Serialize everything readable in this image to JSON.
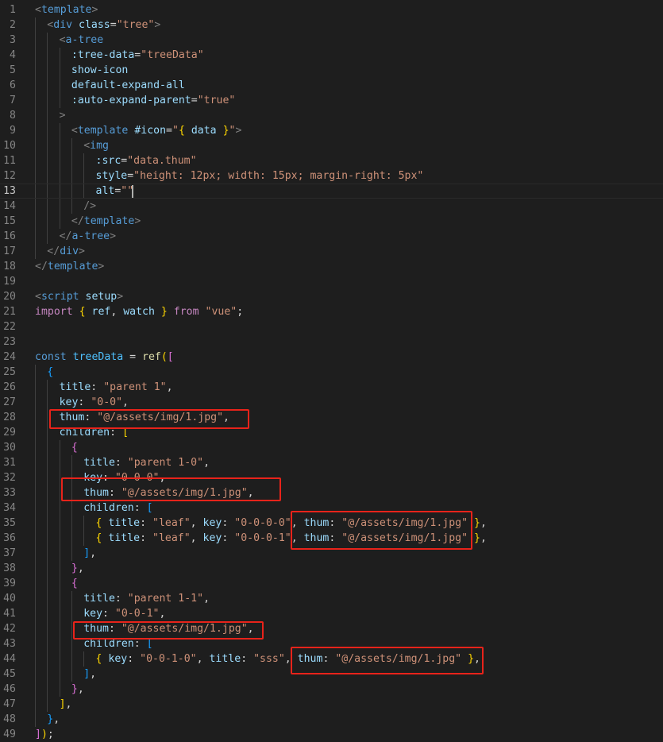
{
  "editor": {
    "language": "vue",
    "cursor_line": 13,
    "lines": [
      {
        "n": "1",
        "indent": 0,
        "tokens": [
          [
            "punc",
            "<"
          ],
          [
            "tag",
            "template"
          ],
          [
            "punc",
            ">"
          ]
        ]
      },
      {
        "n": "2",
        "indent": 1,
        "tokens": [
          [
            "punc",
            "<"
          ],
          [
            "tag",
            "div"
          ],
          [
            "txt",
            " "
          ],
          [
            "attr",
            "class"
          ],
          [
            "txt",
            "="
          ],
          [
            "str",
            "\"tree\""
          ],
          [
            "punc",
            ">"
          ]
        ]
      },
      {
        "n": "3",
        "indent": 2,
        "tokens": [
          [
            "punc",
            "<"
          ],
          [
            "tag",
            "a-tree"
          ]
        ]
      },
      {
        "n": "4",
        "indent": 3,
        "tokens": [
          [
            "attr",
            ":tree-data"
          ],
          [
            "txt",
            "="
          ],
          [
            "str",
            "\"treeData\""
          ]
        ]
      },
      {
        "n": "5",
        "indent": 3,
        "tokens": [
          [
            "attr",
            "show-icon"
          ]
        ]
      },
      {
        "n": "6",
        "indent": 3,
        "tokens": [
          [
            "attr",
            "default-expand-all"
          ]
        ]
      },
      {
        "n": "7",
        "indent": 3,
        "tokens": [
          [
            "attr",
            ":auto-expand-parent"
          ],
          [
            "txt",
            "="
          ],
          [
            "str",
            "\"true\""
          ]
        ]
      },
      {
        "n": "8",
        "indent": 2,
        "tokens": [
          [
            "punc",
            ">"
          ]
        ]
      },
      {
        "n": "9",
        "indent": 3,
        "tokens": [
          [
            "punc",
            "<"
          ],
          [
            "tag",
            "template"
          ],
          [
            "txt",
            " "
          ],
          [
            "attr",
            "#icon"
          ],
          [
            "txt",
            "="
          ],
          [
            "str",
            "\""
          ],
          [
            "br1",
            "{"
          ],
          [
            "txt",
            " "
          ],
          [
            "attr",
            "data"
          ],
          [
            "txt",
            " "
          ],
          [
            "br1",
            "}"
          ],
          [
            "str",
            "\""
          ],
          [
            "punc",
            ">"
          ]
        ]
      },
      {
        "n": "10",
        "indent": 4,
        "tokens": [
          [
            "punc",
            "<"
          ],
          [
            "tag",
            "img"
          ]
        ]
      },
      {
        "n": "11",
        "indent": 5,
        "tokens": [
          [
            "attr",
            ":src"
          ],
          [
            "txt",
            "="
          ],
          [
            "str",
            "\"data.thum\""
          ]
        ]
      },
      {
        "n": "12",
        "indent": 5,
        "tokens": [
          [
            "attr",
            "style"
          ],
          [
            "txt",
            "="
          ],
          [
            "str",
            "\"height: 12px; width: 15px; margin-right: 5px\""
          ]
        ]
      },
      {
        "n": "13",
        "indent": 5,
        "tokens": [
          [
            "attr",
            "alt"
          ],
          [
            "txt",
            "="
          ],
          [
            "str",
            "\"\""
          ]
        ]
      },
      {
        "n": "14",
        "indent": 4,
        "tokens": [
          [
            "punc",
            "/>"
          ]
        ]
      },
      {
        "n": "15",
        "indent": 3,
        "tokens": [
          [
            "punc",
            "</"
          ],
          [
            "tag",
            "template"
          ],
          [
            "punc",
            ">"
          ]
        ]
      },
      {
        "n": "16",
        "indent": 2,
        "tokens": [
          [
            "punc",
            "</"
          ],
          [
            "tag",
            "a-tree"
          ],
          [
            "punc",
            ">"
          ]
        ]
      },
      {
        "n": "17",
        "indent": 1,
        "tokens": [
          [
            "punc",
            "</"
          ],
          [
            "tag",
            "div"
          ],
          [
            "punc",
            ">"
          ]
        ]
      },
      {
        "n": "18",
        "indent": 0,
        "tokens": [
          [
            "punc",
            "</"
          ],
          [
            "tag",
            "template"
          ],
          [
            "punc",
            ">"
          ]
        ]
      },
      {
        "n": "19",
        "indent": 0,
        "tokens": []
      },
      {
        "n": "20",
        "indent": 0,
        "tokens": [
          [
            "punc",
            "<"
          ],
          [
            "tag",
            "script"
          ],
          [
            "txt",
            " "
          ],
          [
            "attr",
            "setup"
          ],
          [
            "punc",
            ">"
          ]
        ]
      },
      {
        "n": "21",
        "indent": 0,
        "tokens": [
          [
            "kw",
            "import"
          ],
          [
            "txt",
            " "
          ],
          [
            "br1",
            "{"
          ],
          [
            "txt",
            " "
          ],
          [
            "prop",
            "ref"
          ],
          [
            "txt",
            ", "
          ],
          [
            "prop",
            "watch"
          ],
          [
            "txt",
            " "
          ],
          [
            "br1",
            "}"
          ],
          [
            "txt",
            " "
          ],
          [
            "kw",
            "from"
          ],
          [
            "txt",
            " "
          ],
          [
            "str",
            "\"vue\""
          ],
          [
            "txt",
            ";"
          ]
        ]
      },
      {
        "n": "22",
        "indent": 0,
        "tokens": []
      },
      {
        "n": "23",
        "indent": 0,
        "tokens": []
      },
      {
        "n": "24",
        "indent": 0,
        "tokens": [
          [
            "kwb",
            "const"
          ],
          [
            "txt",
            " "
          ],
          [
            "var",
            "treeData"
          ],
          [
            "txt",
            " = "
          ],
          [
            "fn",
            "ref"
          ],
          [
            "br1",
            "("
          ],
          [
            "br2",
            "["
          ]
        ]
      },
      {
        "n": "25",
        "indent": 1,
        "tokens": [
          [
            "br3",
            "{"
          ]
        ]
      },
      {
        "n": "26",
        "indent": 2,
        "tokens": [
          [
            "prop",
            "title"
          ],
          [
            "txt",
            ": "
          ],
          [
            "str",
            "\"parent 1\""
          ],
          [
            "txt",
            ","
          ]
        ]
      },
      {
        "n": "27",
        "indent": 2,
        "tokens": [
          [
            "prop",
            "key"
          ],
          [
            "txt",
            ": "
          ],
          [
            "str",
            "\"0-0\""
          ],
          [
            "txt",
            ","
          ]
        ]
      },
      {
        "n": "28",
        "indent": 2,
        "tokens": [
          [
            "prop",
            "thum"
          ],
          [
            "txt",
            ": "
          ],
          [
            "str",
            "\"@/assets/img/1.jpg\""
          ],
          [
            "txt",
            ","
          ]
        ]
      },
      {
        "n": "29",
        "indent": 2,
        "tokens": [
          [
            "prop",
            "children"
          ],
          [
            "txt",
            ": "
          ],
          [
            "br1",
            "["
          ]
        ]
      },
      {
        "n": "30",
        "indent": 3,
        "tokens": [
          [
            "br2",
            "{"
          ]
        ]
      },
      {
        "n": "31",
        "indent": 4,
        "tokens": [
          [
            "prop",
            "title"
          ],
          [
            "txt",
            ": "
          ],
          [
            "str",
            "\"parent 1-0\""
          ],
          [
            "txt",
            ","
          ]
        ]
      },
      {
        "n": "32",
        "indent": 4,
        "tokens": [
          [
            "prop",
            "key"
          ],
          [
            "txt",
            ": "
          ],
          [
            "str",
            "\"0-0-0\""
          ],
          [
            "txt",
            ","
          ]
        ]
      },
      {
        "n": "33",
        "indent": 4,
        "tokens": [
          [
            "prop",
            "thum"
          ],
          [
            "txt",
            ": "
          ],
          [
            "str",
            "\"@/assets/img/1.jpg\""
          ],
          [
            "txt",
            ","
          ]
        ]
      },
      {
        "n": "34",
        "indent": 4,
        "tokens": [
          [
            "prop",
            "children"
          ],
          [
            "txt",
            ": "
          ],
          [
            "br3",
            "["
          ]
        ]
      },
      {
        "n": "35",
        "indent": 5,
        "tokens": [
          [
            "br1",
            "{"
          ],
          [
            "txt",
            " "
          ],
          [
            "prop",
            "title"
          ],
          [
            "txt",
            ": "
          ],
          [
            "str",
            "\"leaf\""
          ],
          [
            "txt",
            ", "
          ],
          [
            "prop",
            "key"
          ],
          [
            "txt",
            ": "
          ],
          [
            "str",
            "\"0-0-0-0\""
          ],
          [
            "txt",
            ", "
          ],
          [
            "prop",
            "thum"
          ],
          [
            "txt",
            ": "
          ],
          [
            "str",
            "\"@/assets/img/1.jpg\""
          ],
          [
            "txt",
            " "
          ],
          [
            "br1",
            "}"
          ],
          [
            "txt",
            ","
          ]
        ]
      },
      {
        "n": "36",
        "indent": 5,
        "tokens": [
          [
            "br1",
            "{"
          ],
          [
            "txt",
            " "
          ],
          [
            "prop",
            "title"
          ],
          [
            "txt",
            ": "
          ],
          [
            "str",
            "\"leaf\""
          ],
          [
            "txt",
            ", "
          ],
          [
            "prop",
            "key"
          ],
          [
            "txt",
            ": "
          ],
          [
            "str",
            "\"0-0-0-1\""
          ],
          [
            "txt",
            ", "
          ],
          [
            "prop",
            "thum"
          ],
          [
            "txt",
            ": "
          ],
          [
            "str",
            "\"@/assets/img/1.jpg\""
          ],
          [
            "txt",
            " "
          ],
          [
            "br1",
            "}"
          ],
          [
            "txt",
            ","
          ]
        ]
      },
      {
        "n": "37",
        "indent": 4,
        "tokens": [
          [
            "br3",
            "]"
          ],
          [
            "txt",
            ","
          ]
        ]
      },
      {
        "n": "38",
        "indent": 3,
        "tokens": [
          [
            "br2",
            "}"
          ],
          [
            "txt",
            ","
          ]
        ]
      },
      {
        "n": "39",
        "indent": 3,
        "tokens": [
          [
            "br2",
            "{"
          ]
        ]
      },
      {
        "n": "40",
        "indent": 4,
        "tokens": [
          [
            "prop",
            "title"
          ],
          [
            "txt",
            ": "
          ],
          [
            "str",
            "\"parent 1-1\""
          ],
          [
            "txt",
            ","
          ]
        ]
      },
      {
        "n": "41",
        "indent": 4,
        "tokens": [
          [
            "prop",
            "key"
          ],
          [
            "txt",
            ": "
          ],
          [
            "str",
            "\"0-0-1\""
          ],
          [
            "txt",
            ","
          ]
        ]
      },
      {
        "n": "42",
        "indent": 4,
        "tokens": [
          [
            "prop",
            "thum"
          ],
          [
            "txt",
            ": "
          ],
          [
            "str",
            "\"@/assets/img/1.jpg\""
          ],
          [
            "txt",
            ","
          ]
        ]
      },
      {
        "n": "43",
        "indent": 4,
        "tokens": [
          [
            "prop",
            "children"
          ],
          [
            "txt",
            ": "
          ],
          [
            "br3",
            "["
          ]
        ]
      },
      {
        "n": "44",
        "indent": 5,
        "tokens": [
          [
            "br1",
            "{"
          ],
          [
            "txt",
            " "
          ],
          [
            "prop",
            "key"
          ],
          [
            "txt",
            ": "
          ],
          [
            "str",
            "\"0-0-1-0\""
          ],
          [
            "txt",
            ", "
          ],
          [
            "prop",
            "title"
          ],
          [
            "txt",
            ": "
          ],
          [
            "str",
            "\"sss\""
          ],
          [
            "txt",
            ", "
          ],
          [
            "prop",
            "thum"
          ],
          [
            "txt",
            ": "
          ],
          [
            "str",
            "\"@/assets/img/1.jpg\""
          ],
          [
            "txt",
            " "
          ],
          [
            "br1",
            "}"
          ],
          [
            "txt",
            ","
          ]
        ]
      },
      {
        "n": "45",
        "indent": 4,
        "tokens": [
          [
            "br3",
            "]"
          ],
          [
            "txt",
            ","
          ]
        ]
      },
      {
        "n": "46",
        "indent": 3,
        "tokens": [
          [
            "br2",
            "}"
          ],
          [
            "txt",
            ","
          ]
        ]
      },
      {
        "n": "47",
        "indent": 2,
        "tokens": [
          [
            "br1",
            "]"
          ],
          [
            "txt",
            ","
          ]
        ]
      },
      {
        "n": "48",
        "indent": 1,
        "tokens": [
          [
            "br3",
            "}"
          ],
          [
            "txt",
            ","
          ]
        ]
      },
      {
        "n": "49",
        "indent": 0,
        "tokens": [
          [
            "br2",
            "]"
          ],
          [
            "br1",
            ")"
          ],
          [
            "txt",
            ";"
          ]
        ]
      }
    ],
    "highlight_color": "#e8231a"
  }
}
